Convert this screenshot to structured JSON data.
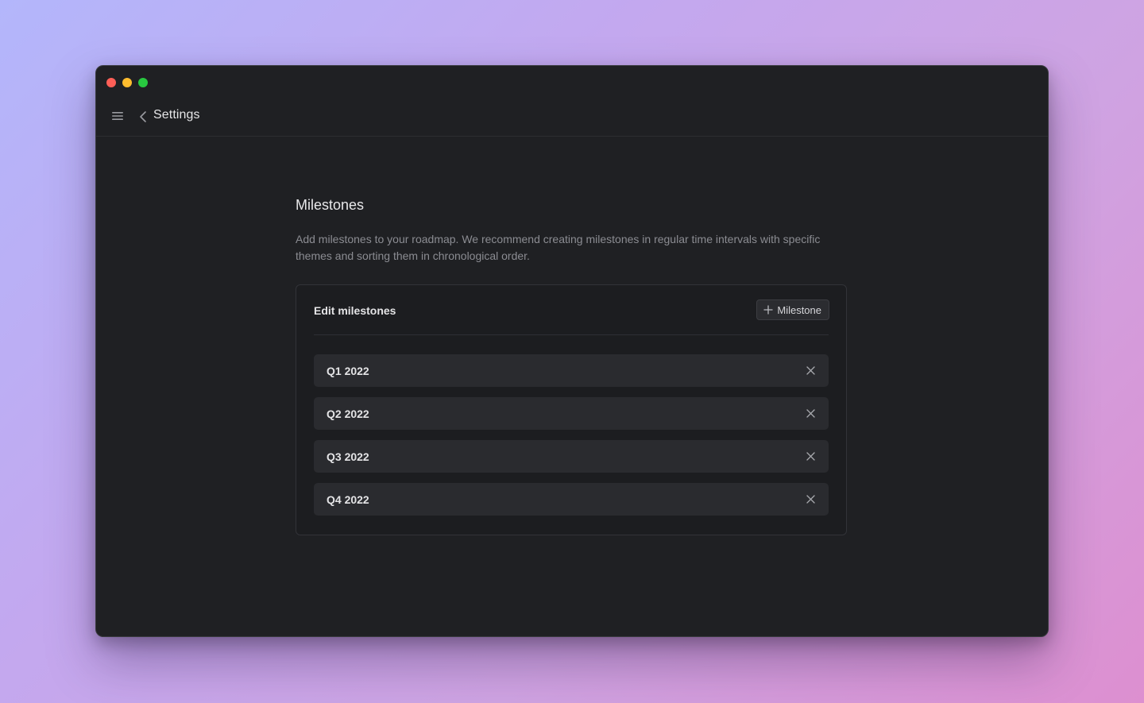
{
  "header": {
    "title": "Settings"
  },
  "section": {
    "title": "Milestones",
    "description": "Add milestones to your roadmap. We recommend creating milestones in regular time intervals with specific themes and sorting them in chronological order."
  },
  "card": {
    "title": "Edit milestones",
    "add_button_label": "Milestone"
  },
  "milestones": [
    {
      "label": "Q1 2022"
    },
    {
      "label": "Q2 2022"
    },
    {
      "label": "Q3 2022"
    },
    {
      "label": "Q4 2022"
    }
  ],
  "icons": {
    "menu": "hamburger-menu-icon",
    "back": "chevron-left-icon",
    "add": "plus-icon",
    "remove": "close-icon"
  },
  "colors": {
    "window_bg": "#1f2023",
    "item_bg": "#2a2b2f",
    "traffic_red": "#fe5f57",
    "traffic_yellow": "#febc2e",
    "traffic_green": "#28c840"
  }
}
